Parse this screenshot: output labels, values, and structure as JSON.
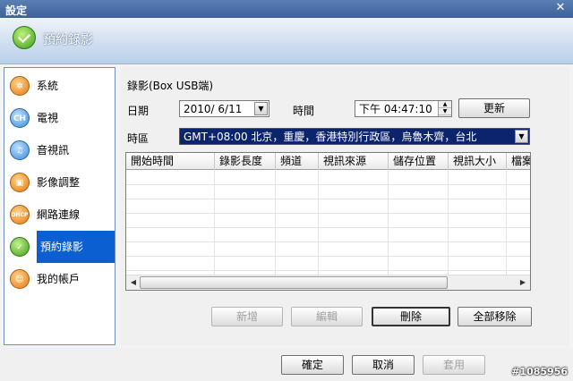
{
  "window": {
    "title": "設定"
  },
  "banner": {
    "title": "預約錄影"
  },
  "sidebar": {
    "items": [
      {
        "label": "系統",
        "icon": "gear-icon",
        "glyph": "✲"
      },
      {
        "label": "電視",
        "icon": "tv-channel-icon",
        "glyph": "CH"
      },
      {
        "label": "音視訊",
        "icon": "audio-video-icon",
        "glyph": "♫"
      },
      {
        "label": "影像調整",
        "icon": "image-adjust-icon",
        "glyph": "▣"
      },
      {
        "label": "網路連線",
        "icon": "network-icon",
        "glyph": "DHCP"
      },
      {
        "label": "預約錄影",
        "icon": "schedule-record-icon",
        "glyph": "✓"
      },
      {
        "label": "我的帳戶",
        "icon": "account-icon",
        "glyph": "☺"
      }
    ],
    "selected": "預約錄影"
  },
  "main": {
    "section_title": "錄影(Box USB端)",
    "date_label": "日期",
    "date_value": "2010/ 6/11",
    "time_label": "時間",
    "time_value": "下午 04:47:10",
    "update_button": "更新",
    "timezone_label": "時區",
    "timezone_value": "GMT+08:00 北京，重慶，香港特別行政區，烏魯木齊，台北",
    "table": {
      "columns": [
        "開始時間",
        "錄影長度",
        "頻道",
        "視訊來源",
        "儲存位置",
        "視訊大小",
        "檔案"
      ],
      "rows": []
    },
    "buttons": {
      "add": "新增",
      "edit": "編輯",
      "delete": "刪除",
      "remove_all": "全部移除"
    }
  },
  "footer": {
    "ok": "確定",
    "cancel": "取消",
    "apply": "套用"
  },
  "watermark": "#1085956",
  "colors": {
    "selection": "#0b5fd1",
    "title_bar": "#3c6299",
    "timezone_highlight": "#0b246b"
  }
}
